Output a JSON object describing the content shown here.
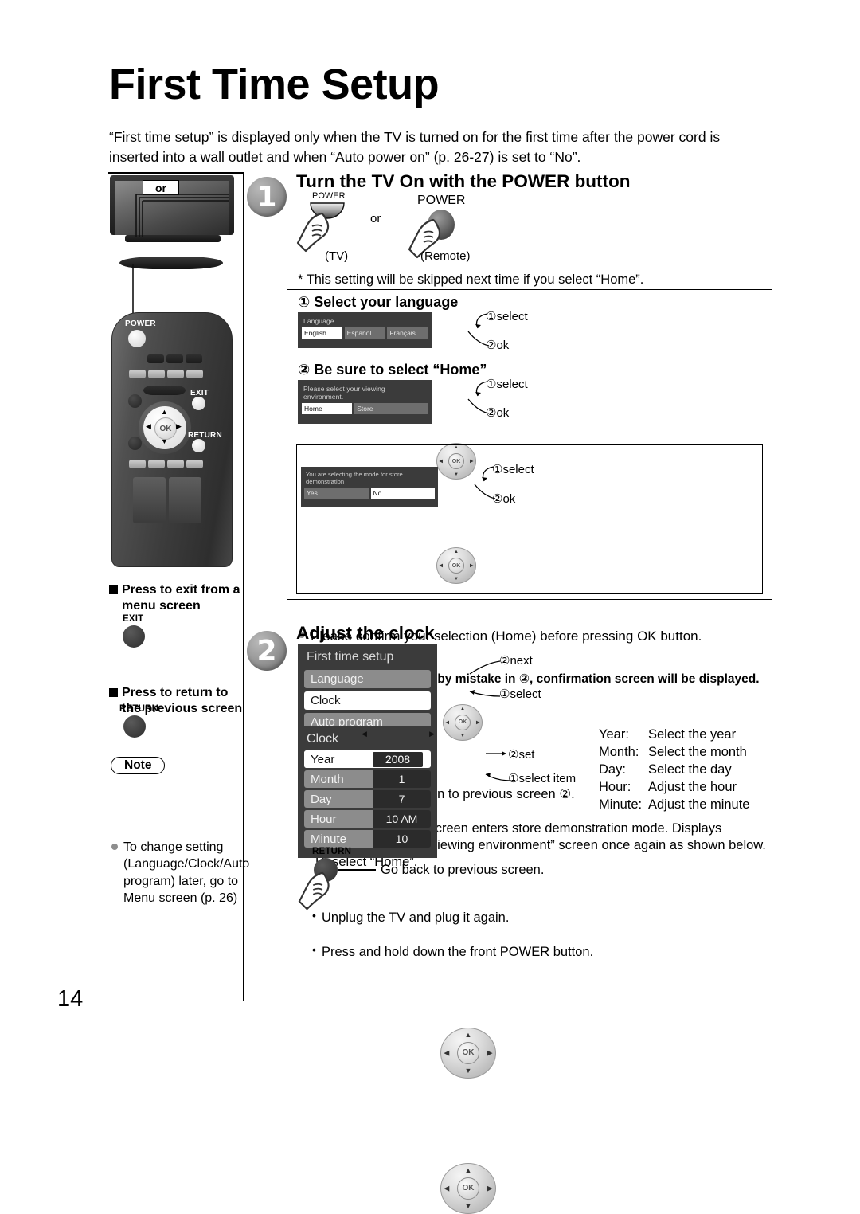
{
  "page": {
    "title": "First Time Setup",
    "intro": "“First time setup” is displayed only when the TV is turned on for the first time after the power cord is inserted into a wall outlet and when “Auto power on” (p. 26-27) is set to “No”.",
    "number": "14"
  },
  "step1": {
    "number": "1",
    "heading": "Turn the TV On with the POWER button",
    "tv_power_label": "POWER",
    "tv_caption": "(TV)",
    "or": "or",
    "remote_power_label": "POWER",
    "remote_caption": "(Remote)",
    "footnote": "* This setting will be skipped next time if you select “Home”.",
    "tv_illustration_or": "or",
    "sub1": {
      "marker": "①",
      "heading": "Select your language",
      "osd": {
        "caption": "Language",
        "options": [
          "English",
          "Español",
          "Français"
        ],
        "selected_index": 0
      },
      "callouts": [
        "①select",
        "②ok"
      ]
    },
    "sub2": {
      "marker": "②",
      "heading": "Be sure to select “Home”",
      "osd": {
        "caption": "Please select your viewing environment.",
        "options": [
          "Home",
          "Store"
        ],
        "selected_index": 0
      },
      "callouts": [
        "①select",
        "②ok"
      ]
    },
    "confirm_note": "Please confirm your selection (Home) before pressing OK button.",
    "store_box": {
      "heading": "If you select “Store” by mistake in ②, confirmation screen will be displayed.",
      "osd": {
        "caption": "You are selecting the mode for store demonstration",
        "options": [
          "Yes",
          "No"
        ],
        "selected_index": 1
      },
      "callouts": [
        "①select",
        "②ok"
      ],
      "bullets": [
        "Select “No” and return to previous screen ②.",
        "If you select “Yes”, Screen enters store demonstration mode. Displays “Please select your viewing environment” screen once again as shown below. Reselect “Home”."
      ],
      "sub_bullets": [
        "Unplug the TV and plug it again.",
        "Press and hold down the front POWER button."
      ]
    }
  },
  "step2": {
    "number": "2",
    "heading": "Adjust the clock",
    "menu": {
      "title": "First time setup",
      "rows": [
        "Language",
        "Clock",
        "Auto program"
      ],
      "selected_index": 1
    },
    "menu_callouts": [
      "②next",
      "①select"
    ],
    "clock": {
      "title": "Clock",
      "rows": [
        {
          "label": "Year",
          "value": "2008"
        },
        {
          "label": "Month",
          "value": "1"
        },
        {
          "label": "Day",
          "value": "7"
        },
        {
          "label": "Hour",
          "value": "10 AM"
        },
        {
          "label": "Minute",
          "value": "10"
        }
      ],
      "selected_index": 0
    },
    "clock_callouts": [
      "②set",
      "①select item"
    ],
    "descriptions": [
      {
        "term": "Year:",
        "desc": "Select the year"
      },
      {
        "term": "Month:",
        "desc": "Select the month"
      },
      {
        "term": "Day:",
        "desc": "Select the day"
      },
      {
        "term": "Hour:",
        "desc": "Adjust the hour"
      },
      {
        "term": "Minute:",
        "desc": "Adjust the minute"
      }
    ],
    "return_label": "RETURN",
    "return_text": "Go back to previous screen."
  },
  "sidebar": {
    "remote_power_label": "POWER",
    "remote_exit_label": "EXIT",
    "remote_return_label": "RETURN",
    "remote_ok_label": "OK",
    "exit_note": "Press to exit from a menu screen",
    "exit_btn_label": "EXIT",
    "return_note": "Press to return to the previous screen",
    "return_btn_label": "RETURN",
    "note_title": "Note",
    "note_text": "To change setting (Language/Clock/Auto program) later, go to Menu screen (p. 26)"
  },
  "colors": {
    "osd_bg": "#3b3b3b",
    "osd_row": "#8c8c8c",
    "osd_selected": "#ffffff",
    "bullet": "#8e8e8e"
  }
}
